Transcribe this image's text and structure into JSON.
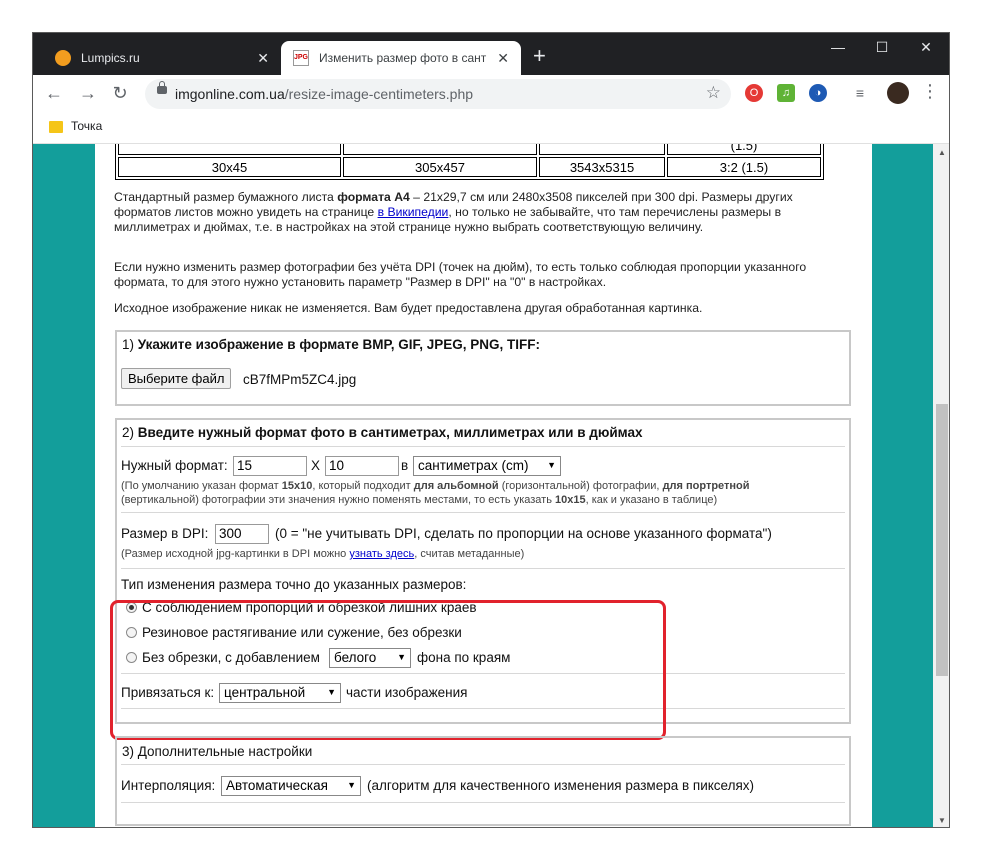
{
  "tabs": [
    {
      "title": "Lumpics.ru",
      "icon": "orange-circle-favicon"
    },
    {
      "title": "Изменить размер фото в санти",
      "icon": "jpg-favicon"
    }
  ],
  "window_controls": {
    "minimize": "—",
    "maximize": "☐",
    "close": "✕"
  },
  "address": {
    "domain": "imgonline.com.ua",
    "path": "/resize-image-centimeters.php"
  },
  "bookmarks": [
    {
      "label": "Точка"
    }
  ],
  "table": {
    "row": [
      "30x45",
      "305x457",
      "3543x5315",
      "3:2 (1.5)"
    ],
    "partial_top": "(1.5)"
  },
  "paragraphs": {
    "a4_1": "Стандартный размер бумажного листа ",
    "a4_bold": "формата А4",
    "a4_2": " – 21x29,7 см или 2480x3508 пикселей при 300 dpi. Размеры других",
    "a4_3": "форматов листов можно увидеть на странице ",
    "a4_link": "в Википедии",
    "a4_4": ", но только не забывайте, что там перечислены размеры в",
    "a4_5": "миллиметрах и дюймах, т.е. в настройках на этой странице нужно выбрать соответствующую величину.",
    "dpi_1": "Если нужно изменить размер фотографии без учёта DPI (точек на дюйм), то есть только соблюдая пропорции указанного",
    "dpi_2": "формата, то для этого нужно установить параметр \"Размер в DPI\" на \"0\" в настройках.",
    "orig": "Исходное изображение никак не изменяется. Вам будет предоставлена другая обработанная картинка."
  },
  "section1": {
    "num": "1) ",
    "title": "Укажите изображение в формате BMP, GIF, JPEG, PNG, TIFF:",
    "button": "Выберите файл",
    "filename": "cB7fMPm5ZC4.jpg"
  },
  "section2": {
    "num": "2) ",
    "title": "Введите нужный формат фото в сантиметрах, миллиметрах или в дюймах",
    "format_label": "Нужный формат:",
    "width": "15",
    "x": "X",
    "height": "10",
    "in": "в",
    "unit": "сантиметрах (cm)",
    "hint1a": "(По умолчанию указан формат ",
    "hint1b": "15x10",
    "hint1c": ", который подходит ",
    "hint1d": "для альбомной",
    "hint1e": " (горизонтальной) фотографии, ",
    "hint1f": "для портретной",
    "hint2a": "(вертикальной) фотографии эти значения нужно поменять местами, то есть указать ",
    "hint2b": "10x15",
    "hint2c": ", как и указано в таблице)",
    "dpi_label": "Размер в DPI:",
    "dpi_value": "300",
    "dpi_note": "(0 = \"не учитывать DPI, сделать по пропорции на основе указанного формата\")",
    "dpi_hint_a": "(Размер исходной jpg-картинки в DPI можно ",
    "dpi_hint_link": "узнать здесь",
    "dpi_hint_b": ", считав метаданные)",
    "resize_type_label": "Тип изменения размера точно до указанных размеров:",
    "opt1": "С соблюдением пропорций и обрезкой лишних краев",
    "opt2": "Резиновое растягивание или сужение, без обрезки",
    "opt3a": "Без обрезки, с добавлением",
    "opt3_color": "белого",
    "opt3b": "фона по краям",
    "anchor_label": "Привязаться к:",
    "anchor_value": "центральной",
    "anchor_suffix": "части изображения"
  },
  "section3": {
    "title": "3) Дополнительные настройки",
    "interp_label": "Интерполяция:",
    "interp_value": "Автоматическая",
    "interp_note": "(алгоритм для качественного изменения размера в пикселях)"
  },
  "colors": {
    "page_bg": "#139e9b",
    "highlight": "#e1222c",
    "link": "#0000cc"
  }
}
